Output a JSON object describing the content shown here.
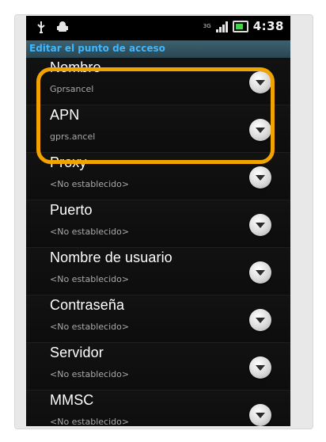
{
  "statusbar": {
    "network": "3G",
    "time": "4:38",
    "icons": [
      "usb-icon",
      "android-icon",
      "signal-icon",
      "battery-icon"
    ]
  },
  "titlebar": {
    "title": "Editar el punto de acceso"
  },
  "settings": [
    {
      "label": "Nombre",
      "value": "Gprsancel"
    },
    {
      "label": "APN",
      "value": "gprs.ancel"
    },
    {
      "label": "Proxy",
      "value": "<No establecido>"
    },
    {
      "label": "Puerto",
      "value": "<No establecido>"
    },
    {
      "label": "Nombre de usuario",
      "value": "<No establecido>"
    },
    {
      "label": "Contraseña",
      "value": "<No establecido>"
    },
    {
      "label": "Servidor",
      "value": "<No establecido>"
    },
    {
      "label": "MMSC",
      "value": "<No establecido>"
    }
  ],
  "colors": {
    "accent": "#3eb7ff",
    "highlight": "#f1a400",
    "background": "#0b0b0b"
  }
}
